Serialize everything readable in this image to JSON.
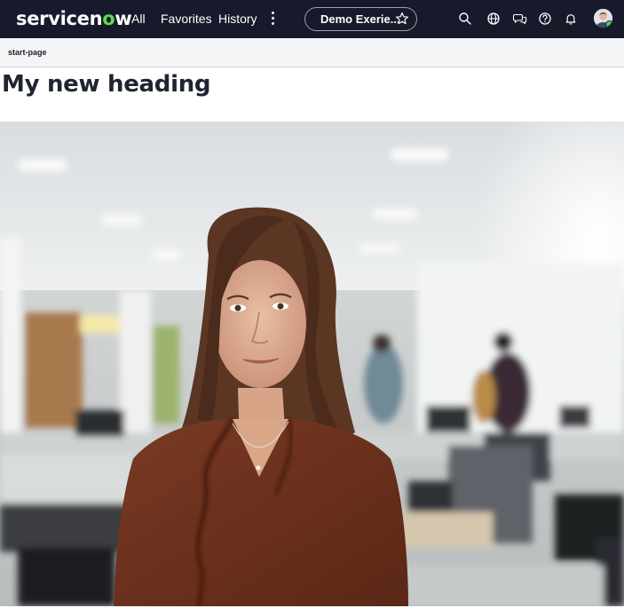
{
  "nav": {
    "logo_prefix": "servicen",
    "logo_o": "o",
    "logo_suffix": "w",
    "links": {
      "all": "All",
      "favorites": "Favorites",
      "history": "History"
    },
    "context_pill_title": "Demo Exerie...",
    "icons": [
      "search-icon",
      "globe-icon",
      "chat-icon",
      "help-icon",
      "notifications-icon"
    ],
    "colors": {
      "nav_bg": "#171a2b",
      "logo_accent": "#62d84e"
    }
  },
  "breadcrumb": {
    "page": "start-page"
  },
  "main": {
    "heading": "My new heading"
  },
  "hero_image": {
    "subject": "hero-photo"
  }
}
